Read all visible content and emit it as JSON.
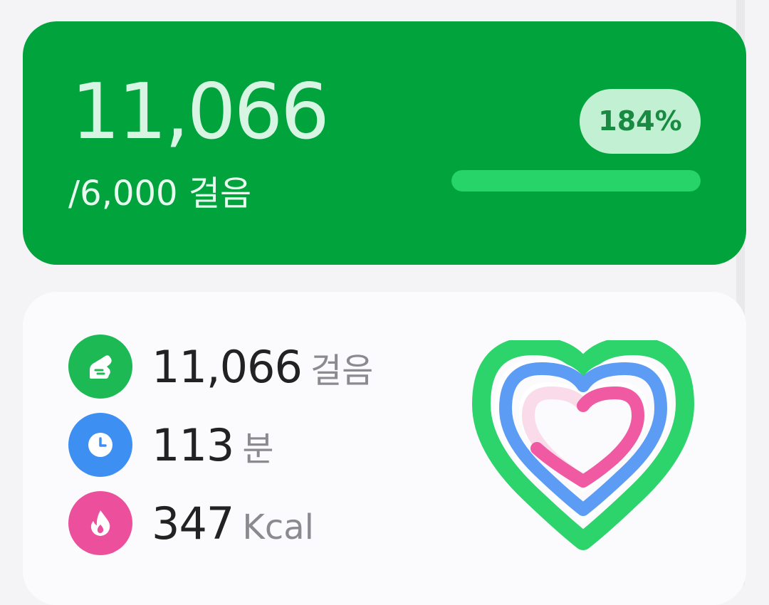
{
  "goal_card": {
    "steps": "11,066",
    "goal": "/6,000 걸음",
    "percent": "184%",
    "progress_fraction": 1.0,
    "color": "#00a33c"
  },
  "summary": {
    "stats": [
      {
        "icon": "shoe-icon",
        "value": "11,066",
        "unit": "걸음",
        "color": "#1db954"
      },
      {
        "icon": "clock-icon",
        "value": "113",
        "unit": "분",
        "color": "#3d8ff2"
      },
      {
        "icon": "flame-icon",
        "value": "347",
        "unit": "Kcal",
        "color": "#ec4f9c"
      }
    ],
    "activity_rings": {
      "icon": "activity-heart-icon",
      "outer_color": "#2dd36b",
      "middle_color": "#5c9cf5",
      "inner_color": "#f05aa3"
    }
  }
}
